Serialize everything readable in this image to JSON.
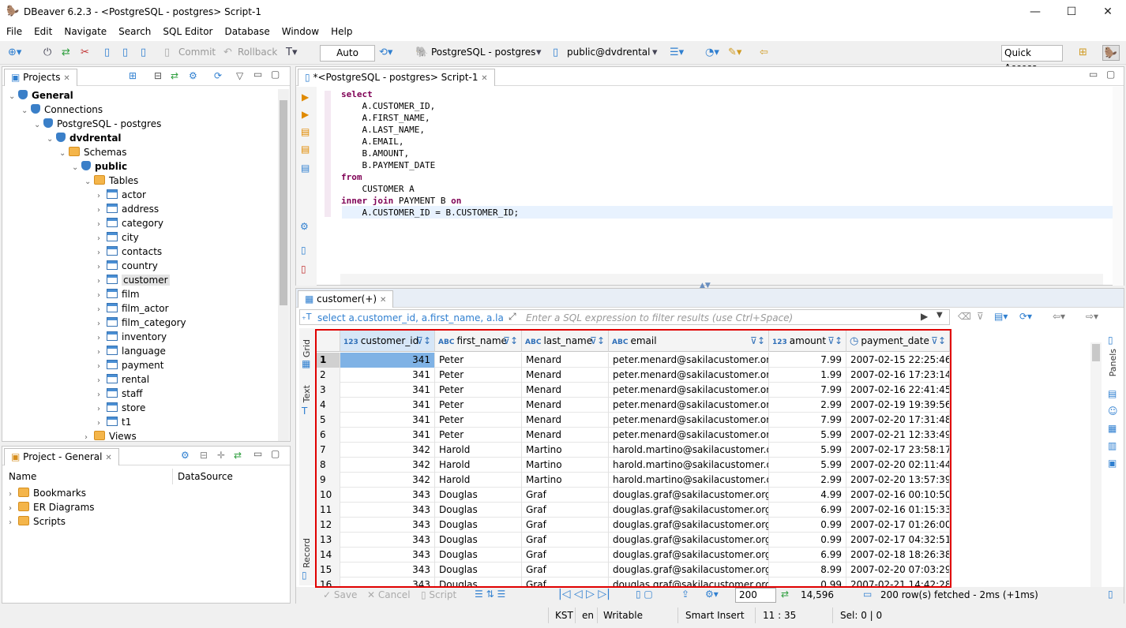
{
  "window": {
    "title": "DBeaver 6.2.3 - <PostgreSQL - postgres> Script-1",
    "min": "—",
    "max": "☐",
    "close": "✕"
  },
  "menu": [
    "File",
    "Edit",
    "Navigate",
    "Search",
    "SQL Editor",
    "Database",
    "Window",
    "Help"
  ],
  "toolbar": {
    "commit": "Commit",
    "rollback": "Rollback",
    "mode": "Auto",
    "connection": "PostgreSQL - postgres",
    "schema": "public@dvdrental",
    "quick_access": "Quick Access"
  },
  "projects": {
    "tab": "Projects",
    "root": "General",
    "connections": "Connections",
    "conn": "PostgreSQL - postgres",
    "db": "dvdrental",
    "schemas": "Schemas",
    "schema": "public",
    "tables_label": "Tables",
    "tables": [
      "actor",
      "address",
      "category",
      "city",
      "contacts",
      "country",
      "customer",
      "film",
      "film_actor",
      "film_category",
      "inventory",
      "language",
      "payment",
      "rental",
      "staff",
      "store",
      "t1"
    ],
    "views": "Views"
  },
  "project_general": {
    "tab": "Project - General",
    "col_name": "Name",
    "col_ds": "DataSource",
    "items": [
      "Bookmarks",
      "ER Diagrams",
      "Scripts"
    ]
  },
  "editor": {
    "tab": "*<PostgreSQL - postgres> Script-1",
    "lines": [
      [
        "kw",
        "select"
      ],
      [
        "",
        "    A.CUSTOMER_ID,"
      ],
      [
        "",
        "    A.FIRST_NAME,"
      ],
      [
        "",
        "    A.LAST_NAME,"
      ],
      [
        "",
        "    A.EMAIL,"
      ],
      [
        "",
        "    B.AMOUNT,"
      ],
      [
        "",
        "    B.PAYMENT_DATE"
      ],
      [
        "kw",
        "from"
      ],
      [
        "",
        "    CUSTOMER A"
      ],
      [
        "kwmix",
        "inner join| PAYMENT B |on"
      ],
      [
        "",
        "    A.CUSTOMER_ID = B.CUSTOMER_ID;"
      ]
    ]
  },
  "results": {
    "tab": "customer(+)",
    "filter_prefix": "select a.customer_id, a.first_name, a.last_nai",
    "filter_placeholder": "Enter a SQL expression to filter results (use Ctrl+Space)",
    "side_tabs": {
      "grid": "Grid",
      "text": "Text",
      "record": "Record"
    },
    "panels": "Panels",
    "columns": [
      {
        "type": "123",
        "name": "customer_id"
      },
      {
        "type": "ABC",
        "name": "first_name"
      },
      {
        "type": "ABC",
        "name": "last_name"
      },
      {
        "type": "ABC",
        "name": "email"
      },
      {
        "type": "123",
        "name": "amount"
      },
      {
        "type": "clock",
        "name": "payment_date"
      }
    ],
    "rows": [
      [
        "1",
        "341",
        "Peter",
        "Menard",
        "peter.menard@sakilacustomer.org",
        "7.99",
        "2007-02-15 22:25:46"
      ],
      [
        "2",
        "341",
        "Peter",
        "Menard",
        "peter.menard@sakilacustomer.org",
        "1.99",
        "2007-02-16 17:23:14"
      ],
      [
        "3",
        "341",
        "Peter",
        "Menard",
        "peter.menard@sakilacustomer.org",
        "7.99",
        "2007-02-16 22:41:45"
      ],
      [
        "4",
        "341",
        "Peter",
        "Menard",
        "peter.menard@sakilacustomer.org",
        "2.99",
        "2007-02-19 19:39:56"
      ],
      [
        "5",
        "341",
        "Peter",
        "Menard",
        "peter.menard@sakilacustomer.org",
        "7.99",
        "2007-02-20 17:31:48"
      ],
      [
        "6",
        "341",
        "Peter",
        "Menard",
        "peter.menard@sakilacustomer.org",
        "5.99",
        "2007-02-21 12:33:49"
      ],
      [
        "7",
        "342",
        "Harold",
        "Martino",
        "harold.martino@sakilacustomer.org",
        "5.99",
        "2007-02-17 23:58:17"
      ],
      [
        "8",
        "342",
        "Harold",
        "Martino",
        "harold.martino@sakilacustomer.org",
        "5.99",
        "2007-02-20 02:11:44"
      ],
      [
        "9",
        "342",
        "Harold",
        "Martino",
        "harold.martino@sakilacustomer.org",
        "2.99",
        "2007-02-20 13:57:39"
      ],
      [
        "10",
        "343",
        "Douglas",
        "Graf",
        "douglas.graf@sakilacustomer.org",
        "4.99",
        "2007-02-16 00:10:50"
      ],
      [
        "11",
        "343",
        "Douglas",
        "Graf",
        "douglas.graf@sakilacustomer.org",
        "6.99",
        "2007-02-16 01:15:33"
      ],
      [
        "12",
        "343",
        "Douglas",
        "Graf",
        "douglas.graf@sakilacustomer.org",
        "0.99",
        "2007-02-17 01:26:00"
      ],
      [
        "13",
        "343",
        "Douglas",
        "Graf",
        "douglas.graf@sakilacustomer.org",
        "0.99",
        "2007-02-17 04:32:51"
      ],
      [
        "14",
        "343",
        "Douglas",
        "Graf",
        "douglas.graf@sakilacustomer.org",
        "6.99",
        "2007-02-18 18:26:38"
      ],
      [
        "15",
        "343",
        "Douglas",
        "Graf",
        "douglas.graf@sakilacustomer.org",
        "8.99",
        "2007-02-20 07:03:29"
      ],
      [
        "16",
        "343",
        "Douglas",
        "Graf",
        "douglas.graf@sakilacustomer.org",
        "0.99",
        "2007-02-21 14:42:28"
      ]
    ],
    "bottom": {
      "save": "Save",
      "cancel": "Cancel",
      "script": "Script",
      "fetch_size": "200",
      "total": "14,596",
      "fetched": "200 row(s) fetched - 2ms (+1ms)"
    }
  },
  "status": {
    "tz": "KST",
    "lang": "en",
    "mode": "Writable",
    "insert": "Smart Insert",
    "pos": "11 : 35",
    "sel": "Sel: 0 | 0"
  },
  "colors": {
    "highlight_border": "#e00000",
    "selected_cell": "#7fb2e5",
    "keyword": "#7f0055"
  }
}
